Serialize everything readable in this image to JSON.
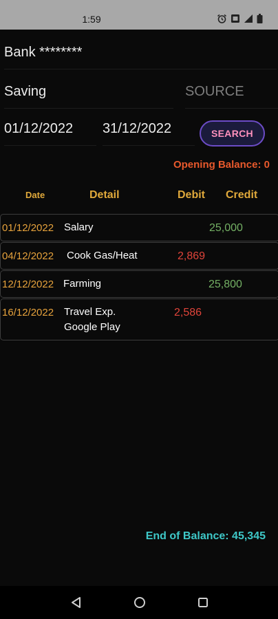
{
  "status_bar": {
    "time": "1:59",
    "icons": [
      "alarm-icon",
      "sim-icon",
      "signal-icon",
      "battery-icon"
    ]
  },
  "form": {
    "bank": "Bank ********",
    "account_type": "Saving",
    "source_placeholder": "SOURCE",
    "date_from": "01/12/2022",
    "date_to": "31/12/2022",
    "search_label": "SEARCH"
  },
  "opening_balance": "Opening Balance: 0",
  "table": {
    "headers": [
      "Date",
      "Detail",
      "Debit",
      "Credit"
    ],
    "rows": [
      {
        "date": "01/12/2022",
        "detail": "Salary",
        "detail_2": "",
        "debit": "",
        "credit": "25,000"
      },
      {
        "date": "04/12/2022",
        "detail": "Cook Gas/Heat",
        "detail_2": "",
        "debit": "2,869",
        "credit": ""
      },
      {
        "date": "12/12/2022",
        "detail": "Farming",
        "detail_2": "",
        "debit": "",
        "credit": "25,800"
      },
      {
        "date": "16/12/2022",
        "detail": "Travel Exp.",
        "detail_2": "Google Play",
        "debit": "2,586",
        "credit": ""
      }
    ]
  },
  "end_balance": "End of Balance: 45,345",
  "colors": {
    "date": "#e6a23c",
    "debit": "#e0443a",
    "credit": "#74b064",
    "opening": "#e8592c",
    "end_balance": "#3ec8c8",
    "search_text": "#ff91bd",
    "search_border": "#6c4cc6"
  },
  "nav": {
    "icons": [
      "back-icon",
      "home-icon",
      "recents-icon"
    ]
  }
}
